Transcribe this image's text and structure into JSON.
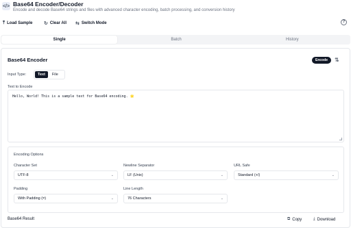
{
  "header": {
    "title": "Base64 Encoder/Decoder",
    "subtitle": "Encode and decode Base64 strings and files with advanced character encoding, batch processing, and conversion history",
    "icon": "code-icon"
  },
  "toolbar": {
    "load_sample": "Load Sample",
    "clear_all": "Clear All",
    "switch_mode": "Switch Mode",
    "help_icon_glyph": "?"
  },
  "tabs": [
    {
      "label": "Single",
      "active": true
    },
    {
      "label": "Batch",
      "active": false
    },
    {
      "label": "History",
      "active": false
    }
  ],
  "card": {
    "title": "Base64 Encoder",
    "mode_badge": "Encode"
  },
  "input_type": {
    "label": "Input Type:",
    "options": [
      "Text",
      "File"
    ],
    "selected": "Text"
  },
  "text_input": {
    "label": "Text to Encode",
    "value": "Hello, World! This is a sample text for Base64 encoding. 🌟"
  },
  "options": {
    "title": "Encoding Options",
    "character_set": {
      "label": "Character Set",
      "value": "UTF-8"
    },
    "newline_separator": {
      "label": "Newline Separator",
      "value": "LF (Unix)"
    },
    "url_safe": {
      "label": "URL Safe",
      "value": "Standard (+/)"
    },
    "padding": {
      "label": "Padding",
      "value": "With Padding (=)"
    },
    "line_length": {
      "label": "Line Length",
      "value": "76 Characters"
    }
  },
  "result": {
    "label": "Base64 Result",
    "copy": "Copy",
    "download": "Download"
  }
}
